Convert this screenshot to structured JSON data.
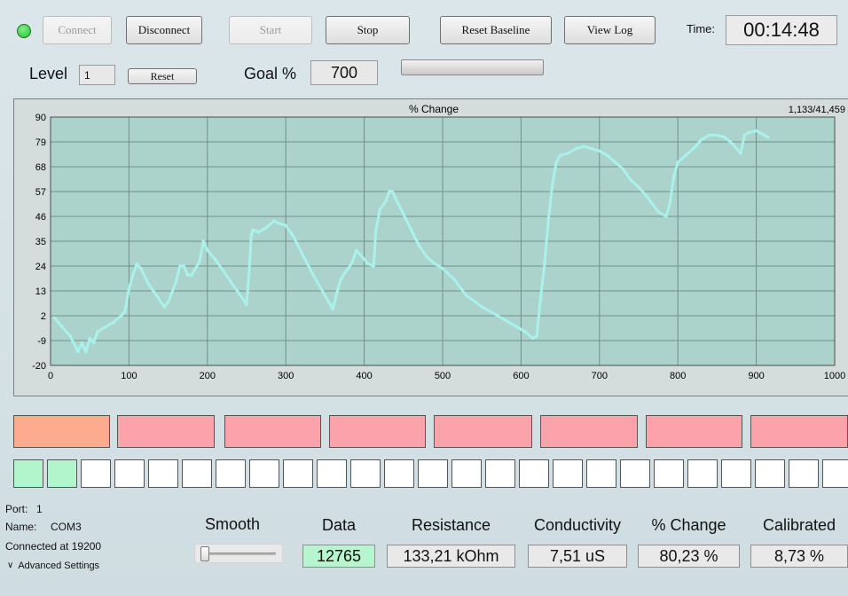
{
  "toolbar": {
    "connect_label": "Connect",
    "disconnect_label": "Disconnect",
    "start_label": "Start",
    "stop_label": "Stop",
    "reset_baseline_label": "Reset Baseline",
    "view_log_label": "View Log",
    "time_label": "Time:",
    "time_value": "00:14:48"
  },
  "level_row": {
    "level_label": "Level",
    "level_value": "1",
    "reset_label": "Reset",
    "goal_label": "Goal %",
    "goal_value": "700",
    "progress": 0
  },
  "chart_data": {
    "type": "line",
    "title": "% Change",
    "counter": "1,133/41,459",
    "xlim": [
      0,
      1000
    ],
    "ylim": [
      -20,
      90
    ],
    "x_ticks": [
      0,
      100,
      200,
      300,
      400,
      500,
      600,
      700,
      800,
      900,
      1000
    ],
    "y_ticks": [
      -20,
      -9,
      2,
      13,
      24,
      35,
      46,
      57,
      68,
      79,
      90
    ],
    "grid": true,
    "background": "#acd3cb",
    "line_color": "#aaf1ec",
    "series": [
      {
        "points": [
          [
            5,
            1
          ],
          [
            15,
            -3
          ],
          [
            25,
            -7
          ],
          [
            35,
            -14
          ],
          [
            40,
            -10
          ],
          [
            45,
            -14
          ],
          [
            50,
            -8
          ],
          [
            55,
            -10
          ],
          [
            60,
            -5
          ],
          [
            70,
            -3
          ],
          [
            80,
            -1
          ],
          [
            90,
            2
          ],
          [
            95,
            4
          ],
          [
            100,
            14
          ],
          [
            105,
            20
          ],
          [
            110,
            25
          ],
          [
            115,
            23
          ],
          [
            125,
            16
          ],
          [
            135,
            11
          ],
          [
            145,
            6
          ],
          [
            150,
            8
          ],
          [
            160,
            17
          ],
          [
            165,
            24
          ],
          [
            170,
            24
          ],
          [
            175,
            20
          ],
          [
            180,
            20
          ],
          [
            190,
            26
          ],
          [
            195,
            35
          ],
          [
            200,
            31
          ],
          [
            210,
            27
          ],
          [
            230,
            17
          ],
          [
            250,
            7
          ],
          [
            253,
            20
          ],
          [
            256,
            38
          ],
          [
            258,
            40
          ],
          [
            265,
            39
          ],
          [
            275,
            41
          ],
          [
            285,
            44
          ],
          [
            290,
            43
          ],
          [
            300,
            42
          ],
          [
            310,
            37
          ],
          [
            320,
            30
          ],
          [
            335,
            20
          ],
          [
            355,
            8
          ],
          [
            360,
            5
          ],
          [
            365,
            12
          ],
          [
            370,
            18
          ],
          [
            375,
            21
          ],
          [
            380,
            23
          ],
          [
            385,
            26
          ],
          [
            390,
            31
          ],
          [
            395,
            29
          ],
          [
            405,
            25
          ],
          [
            412,
            24
          ],
          [
            415,
            40
          ],
          [
            420,
            49
          ],
          [
            428,
            53
          ],
          [
            432,
            57
          ],
          [
            436,
            57
          ],
          [
            440,
            54
          ],
          [
            450,
            47
          ],
          [
            460,
            40
          ],
          [
            470,
            33
          ],
          [
            480,
            28
          ],
          [
            490,
            25
          ],
          [
            500,
            23
          ],
          [
            515,
            18
          ],
          [
            530,
            11
          ],
          [
            550,
            6
          ],
          [
            570,
            2
          ],
          [
            590,
            -2
          ],
          [
            605,
            -5
          ],
          [
            615,
            -8
          ],
          [
            620,
            -7
          ],
          [
            625,
            10
          ],
          [
            630,
            25
          ],
          [
            635,
            45
          ],
          [
            640,
            60
          ],
          [
            645,
            70
          ],
          [
            650,
            73
          ],
          [
            660,
            74
          ],
          [
            670,
            76
          ],
          [
            680,
            77
          ],
          [
            690,
            76
          ],
          [
            700,
            75
          ],
          [
            710,
            73
          ],
          [
            720,
            70
          ],
          [
            730,
            67
          ],
          [
            740,
            62
          ],
          [
            750,
            59
          ],
          [
            760,
            55
          ],
          [
            775,
            48
          ],
          [
            785,
            46
          ],
          [
            790,
            52
          ],
          [
            795,
            64
          ],
          [
            800,
            70
          ],
          [
            810,
            73
          ],
          [
            820,
            76
          ],
          [
            830,
            80
          ],
          [
            840,
            82
          ],
          [
            850,
            82
          ],
          [
            860,
            81
          ],
          [
            870,
            78
          ],
          [
            880,
            74
          ],
          [
            885,
            82
          ],
          [
            890,
            83
          ],
          [
            900,
            84
          ],
          [
            905,
            83
          ],
          [
            910,
            82
          ],
          [
            915,
            81
          ]
        ]
      }
    ]
  },
  "indicators": {
    "tile_colors": [
      "#fdab8e",
      "#fba2aa",
      "#fba2aa",
      "#fba2aa",
      "#fba2aa",
      "#fba2aa",
      "#fba2aa",
      "#fba2aa"
    ],
    "cells_on": 2,
    "cells_total": 25
  },
  "port_info": {
    "port_label": "Port:",
    "port_value": "1",
    "name_label": "Name:",
    "name_value": "COM3",
    "connected_text": "Connected at 19200",
    "advanced_label": "Advanced Settings"
  },
  "metrics": {
    "smooth_label": "Smooth",
    "smooth_value": 0,
    "data_label": "Data",
    "data_value": "12765",
    "resistance_label": "Resistance",
    "resistance_value": "133,21 kOhm",
    "conductivity_label": "Conductivity",
    "conductivity_value": "7,51 uS",
    "change_label": "% Change",
    "change_value": "80,23 %",
    "calibrated_label": "Calibrated",
    "calibrated_value": "8,73 %"
  },
  "colors": {
    "status_led": "#22c42f",
    "data_highlight": "#b6f5cd"
  }
}
